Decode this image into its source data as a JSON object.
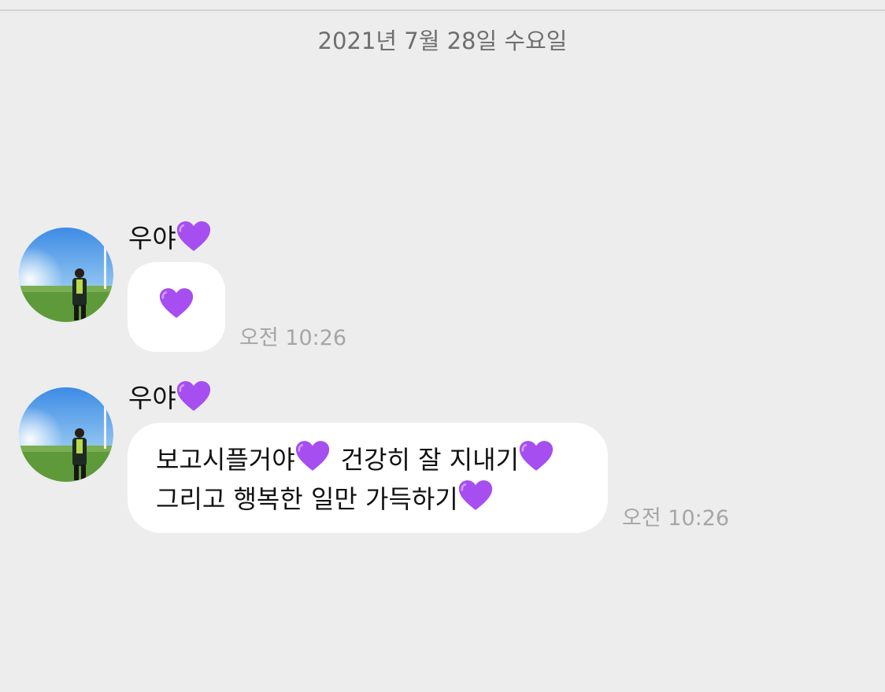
{
  "chat": {
    "date_divider": "2021년 7월 28일 수요일",
    "messages": [
      {
        "sender_name": "우야",
        "sender_emoji": "purple-heart",
        "content_emoji": "purple-heart",
        "time": "오전 10:26"
      },
      {
        "sender_name": "우야",
        "sender_emoji": "purple-heart",
        "line1_part1": "보고시플거야",
        "line1_part2": "건강히 잘 지내기",
        "line2_part1": "그리고 행복한 일만 가득하기",
        "time": "오전 10:26"
      }
    ]
  },
  "colors": {
    "background": "#ededed",
    "bubble": "#ffffff",
    "timestamp": "#a6a6a6",
    "date_text": "#6e6e6e",
    "heart": "#a64ef0"
  }
}
